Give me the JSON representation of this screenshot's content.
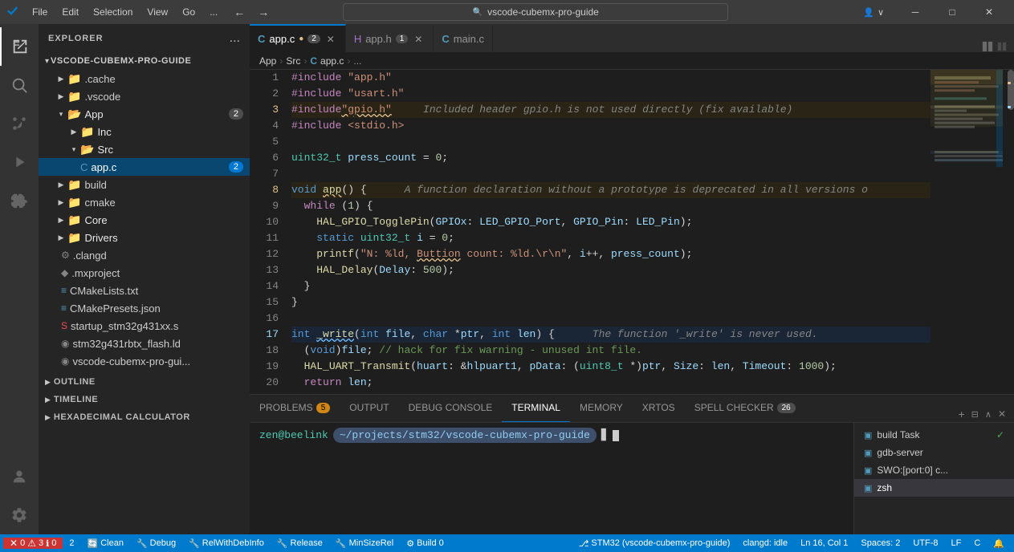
{
  "titlebar": {
    "menu": [
      "File",
      "Edit",
      "Selection",
      "View",
      "Go"
    ],
    "more_label": "...",
    "search_placeholder": "vscode-cubemx-pro-guide",
    "nav_back": "←",
    "nav_forward": "→"
  },
  "sidebar": {
    "title": "EXPLORER",
    "more_btn": "...",
    "root_label": "VSCODE-CUBEMX-PRO-GUIDE",
    "tree": [
      {
        "id": "cache",
        "label": ".cache",
        "type": "folder",
        "depth": 1,
        "icon": "folder",
        "color": "gray"
      },
      {
        "id": "vscode",
        "label": ".vscode",
        "type": "folder",
        "depth": 1,
        "icon": "folder",
        "color": "gray"
      },
      {
        "id": "App",
        "label": "App",
        "type": "folder",
        "depth": 1,
        "icon": "folder-app",
        "color": "blue",
        "badge": 2,
        "expanded": true
      },
      {
        "id": "Inc",
        "label": "Inc",
        "type": "folder",
        "depth": 2,
        "icon": "folder-inc",
        "color": "orange",
        "badge": null
      },
      {
        "id": "Src",
        "label": "Src",
        "type": "folder",
        "depth": 2,
        "icon": "folder-src",
        "color": "orange",
        "expanded": true
      },
      {
        "id": "app.c",
        "label": "app.c",
        "type": "file",
        "depth": 3,
        "icon": "file-c",
        "color": "blue",
        "badge": 2,
        "active": true
      },
      {
        "id": "build",
        "label": "build",
        "type": "folder",
        "depth": 1,
        "icon": "folder",
        "color": "gray"
      },
      {
        "id": "cmake",
        "label": "cmake",
        "type": "folder",
        "depth": 1,
        "icon": "folder",
        "color": "gray"
      },
      {
        "id": "Core",
        "label": "Core",
        "type": "folder",
        "depth": 1,
        "icon": "folder-core",
        "color": "blue"
      },
      {
        "id": "Drivers",
        "label": "Drivers",
        "type": "folder",
        "depth": 1,
        "icon": "folder-drivers",
        "color": "orange"
      },
      {
        "id": ".clangd",
        "label": ".clangd",
        "type": "file",
        "depth": 1,
        "icon": "file-clangd",
        "color": "gray"
      },
      {
        "id": ".mxproject",
        "label": ".mxproject",
        "type": "file",
        "depth": 1,
        "icon": "file-misc",
        "color": "gray"
      },
      {
        "id": "CMakeLists.txt",
        "label": "CMakeLists.txt",
        "type": "file",
        "depth": 1,
        "icon": "file-cmake",
        "color": "blue"
      },
      {
        "id": "CMakePresets.json",
        "label": "CMakePresets.json",
        "type": "file",
        "depth": 1,
        "icon": "file-cmake",
        "color": "blue"
      },
      {
        "id": "startup_stm32g431xx.s",
        "label": "startup_stm32g431xx.s",
        "type": "file",
        "depth": 1,
        "icon": "file-misc",
        "color": "red"
      },
      {
        "id": "stm32g431rbtx_flash.ld",
        "label": "stm32g431rbtx_flash.ld",
        "type": "file",
        "depth": 1,
        "icon": "file-misc",
        "color": "gray"
      },
      {
        "id": "vscode-cubemx-pro-gui...",
        "label": "vscode-cubemx-pro-gui...",
        "type": "file",
        "depth": 1,
        "icon": "file-misc",
        "color": "gray"
      }
    ],
    "outline_label": "OUTLINE",
    "timeline_label": "TIMELINE",
    "hexcalc_label": "HEXADECIMAL CALCULATOR"
  },
  "tabs": [
    {
      "id": "app.c",
      "label": "app.c",
      "icon": "c-icon",
      "active": true,
      "dirty": true,
      "modified": 2,
      "closable": true
    },
    {
      "id": "app.h",
      "label": "app.h",
      "icon": "h-icon",
      "active": false,
      "dirty": false,
      "modified": 1,
      "closable": true
    },
    {
      "id": "main.c",
      "label": "main.c",
      "icon": "c-icon",
      "active": false,
      "dirty": false,
      "modified": null,
      "closable": false
    }
  ],
  "breadcrumb": [
    "App",
    "Src",
    "app.c",
    "..."
  ],
  "code": {
    "lines": [
      {
        "num": 1,
        "content": "#include \"app.h\"",
        "type": "normal"
      },
      {
        "num": 2,
        "content": "#include \"usart.h\"",
        "type": "normal"
      },
      {
        "num": 3,
        "content": "#include \"gpio.h\"    Included header gpio.h is not used directly (fix available)",
        "type": "warning"
      },
      {
        "num": 4,
        "content": "#include <stdio.h>",
        "type": "normal"
      },
      {
        "num": 5,
        "content": "",
        "type": "normal"
      },
      {
        "num": 6,
        "content": "uint32_t press_count = 0;",
        "type": "normal"
      },
      {
        "num": 7,
        "content": "",
        "type": "normal"
      },
      {
        "num": 8,
        "content": "void app() {     A function declaration without a prototype is deprecated in all versions o",
        "type": "warning"
      },
      {
        "num": 9,
        "content": "  while (1) {",
        "type": "normal"
      },
      {
        "num": 10,
        "content": "    HAL_GPIO_TogglePin(GPIOx: LED_GPIO_Port, GPIO_Pin: LED_Pin);",
        "type": "normal"
      },
      {
        "num": 11,
        "content": "    static uint32_t i = 0;",
        "type": "normal"
      },
      {
        "num": 12,
        "content": "    printf(\"N: %ld, Buttion count: %ld.\\r\\n\", i++, press_count);",
        "type": "normal"
      },
      {
        "num": 13,
        "content": "    HAL_Delay(Delay: 500);",
        "type": "normal"
      },
      {
        "num": 14,
        "content": "  }",
        "type": "normal"
      },
      {
        "num": 15,
        "content": "}",
        "type": "normal"
      },
      {
        "num": 16,
        "content": "",
        "type": "normal"
      },
      {
        "num": 17,
        "content": "int _write(int file, char *ptr, int len) {     The function '_write' is never used.",
        "type": "info"
      },
      {
        "num": 18,
        "content": "  (void)file; // hack for fix warning - unused int file.",
        "type": "normal"
      },
      {
        "num": 19,
        "content": "  HAL_UART_Transmit(huart: &hlpuart1, pData: (uint8_t *)ptr, Size: len, Timeout: 1000);",
        "type": "normal"
      },
      {
        "num": 20,
        "content": "  return len;",
        "type": "normal"
      }
    ]
  },
  "panel": {
    "tabs": [
      {
        "id": "problems",
        "label": "PROBLEMS",
        "badge": 5,
        "active": false
      },
      {
        "id": "output",
        "label": "OUTPUT",
        "badge": null,
        "active": false
      },
      {
        "id": "debug_console",
        "label": "DEBUG CONSOLE",
        "badge": null,
        "active": false
      },
      {
        "id": "terminal",
        "label": "TERMINAL",
        "badge": null,
        "active": true
      },
      {
        "id": "memory",
        "label": "MEMORY",
        "badge": null,
        "active": false
      },
      {
        "id": "xrtos",
        "label": "XRTOS",
        "badge": null,
        "active": false
      },
      {
        "id": "spell_checker",
        "label": "SPELL CHECKER",
        "badge": 26,
        "active": false
      }
    ],
    "terminal": {
      "user": "zen@beelink",
      "path": "~/projects/stm32/vscode-cubemx-pro-guide",
      "cursor": "▊"
    },
    "terminal_list": [
      {
        "id": "build",
        "label": "build Task",
        "active": false,
        "check": true
      },
      {
        "id": "gdb-server",
        "label": "gdb-server",
        "active": false,
        "check": false
      },
      {
        "id": "swo",
        "label": "SWO:[port:0] c...",
        "active": false,
        "check": false
      },
      {
        "id": "zsh",
        "label": "zsh",
        "active": true,
        "check": false
      }
    ]
  },
  "statusbar": {
    "errors": "0",
    "warnings": "3",
    "infos": "0",
    "errors_count": "2",
    "clean_label": "Clean",
    "debug_label": "Debug",
    "relwithdebinfo_label": "RelWithDebInfo",
    "release_label": "Release",
    "minsizerel_label": "MinSizeRel",
    "build_label": "Build",
    "build_count": "0",
    "branch_label": "STM32 (vscode-cubemx-pro-guide)",
    "clangd_label": "clangd: idle",
    "line_col": "Ln 16, Col 1",
    "spaces": "Spaces: 2",
    "encoding": "UTF-8",
    "line_ending": "LF",
    "file_type": "C"
  },
  "colors": {
    "accent": "#007acc",
    "sidebar_bg": "#252526",
    "editor_bg": "#1e1e1e",
    "tab_active_bg": "#1e1e1e",
    "tab_inactive_bg": "#2d2d2d",
    "status_bg": "#007acc",
    "status_error_bg": "#cc3333"
  }
}
